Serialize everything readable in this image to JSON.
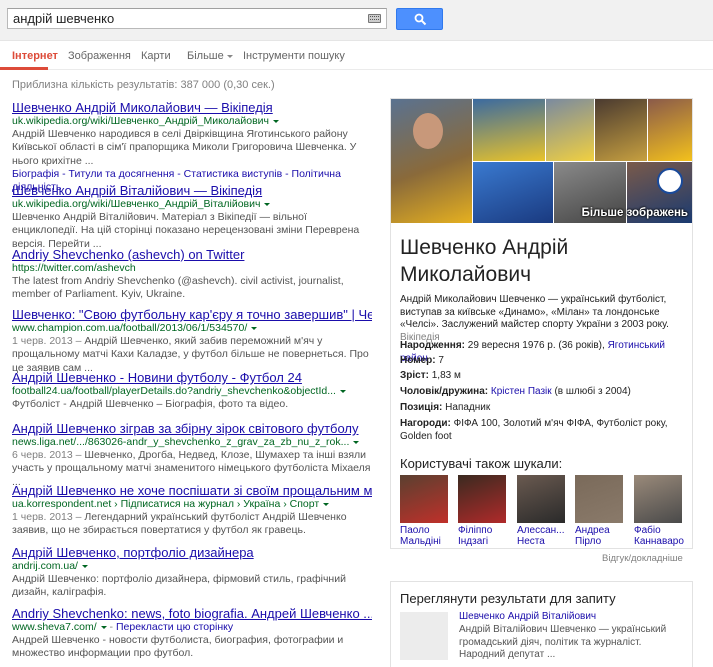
{
  "search": {
    "query": "андрій шевченко",
    "keyboard_icon": "keyboard-icon",
    "button_icon": "magnifier-icon",
    "accent": "#4d90fe"
  },
  "tabs": [
    {
      "label": "Інтернет",
      "active": true
    },
    {
      "label": "Зображення"
    },
    {
      "label": "Карти"
    },
    {
      "label": "Більше"
    },
    {
      "label": "Інструменти пошуку"
    }
  ],
  "stats": "Приблизна кількість результатів: 387 000 (0,30 сек.)",
  "results": [
    {
      "title": "Шевченко Андрій Миколайович — Вікіпедія",
      "url": "uk.wikipedia.org/wiki/Шевченко_Андрій_Миколайович",
      "snippet": "Андрій Шевченко народився в селі Двірківщина Яготинського району Київської області в сім'ї прапорщика Миколи Григоровича Шевченка. У нього крихітне ...",
      "sitelinks": "Біографія - Титули та досягнення - Статистика виступів - Політична діяльність"
    },
    {
      "title": "Шевченко Андрій Віталійович — Вікіпедія",
      "url": "uk.wikipedia.org/wiki/Шевченко_Андрій_Віталійович",
      "snippet": "Шевченко Андрій Віталійович. Матеріал з Вікіпедії — вільної енциклопедії. На цій сторінці показано нерецензовані зміни Переврена версія. Перейти ..."
    },
    {
      "title": "Andriy Shevchenko (ashevch) on Twitter",
      "url": "https://twitter.com/ashevch",
      "snippet": "The latest from Andriy Shevchenko (@ashevch). civil activist, journalist, member of Parliament. Kyiv, Ukraine."
    },
    {
      "title": "Шевченко: \"Свою футбольну кар'єру я точно завершив\" | Чемпіон",
      "url": "www.champion.com.ua/football/2013/06/1/534570/",
      "snippet_date": "1 черв. 2013 –",
      "snippet": "Андрій Шевченко, який забив переможний м'яч у прощальному матчі Кахи Каладзе, у футбол більше не повернеться. Про це заявив сам ..."
    },
    {
      "title": "Андрій Шевченко - Новини футболу - Футбол 24",
      "url": "football24.ua/football/playerDetails.do?andriy_shevchenko&objectId...",
      "snippet": "Футболіст - Андрій Шевченко – Біографія, фото та відео."
    },
    {
      "title": "Андрій Шевченко зіграв за збірну зірок світового футболу",
      "url": "news.liga.net/.../863026-andr_y_shevchenko_z_grav_za_zb_nu_z_rok...",
      "snippet_date": "6 черв. 2013 –",
      "snippet": "Шевченко, Дрогба, Недвед, Клозе, Шумахер та інші взяли участь у прощальному матчі знаменитого німецького футболіста Міхаеля ..."
    },
    {
      "title": "Андрій Шевченко не хоче поспішати зі своїм прощальним мат...",
      "url": "ua.korrespondent.net › Підписатися на журнал › Україна › Спорт",
      "snippet_date": "1 черв. 2013 –",
      "snippet": "Легендарний український футболіст Андрій Шевченко заявив, що не збирається повертатися у футбол як гравець."
    },
    {
      "title": "Андрій Шевченко, портфоліо дизайнера",
      "url": "andrij.com.ua/",
      "snippet": "Андрій Шевченко: портфоліо дизайнера, фірмовий стиль, графічний дизайн, каліграфія."
    },
    {
      "title": "Andriy Shevchenko: news, foto biografia. Андрей Шевченко ...",
      "url": "www.sheva7.com/",
      "url_extra": "Перекласти цю сторінку",
      "snippet": "Андрей Шевченко - новости футболиста, биография, фотографии и множество информации про футбол."
    }
  ],
  "knowledge": {
    "more_images": "Більше зображень",
    "title": "Шевченко Андрій Миколайович",
    "description": "Андрій Миколайович Шевченко — український футболіст, виступав за київське «Динамо», «Мілан» та лондонське «Челсі». Заслужений майстер спорту України з 2003 року.",
    "wiki": "Вікіпедія",
    "facts": [
      {
        "label": "Народження:",
        "value": "29 вересня 1976 р. (36 років),",
        "link": "Яготинський район"
      },
      {
        "label": "Номер:",
        "value": "7"
      },
      {
        "label": "Зріст:",
        "value": "1,83 м"
      },
      {
        "label": "Чоловік/дружина:",
        "link": "Крістен Пазік",
        "value": "(в шлюбі з 2004)"
      },
      {
        "label": "Позиція:",
        "value": "Нападник"
      },
      {
        "label": "Нагороди:",
        "value": "ФІФА 100, Золотий м'яч ФІФА, Футболіст року, Golden foot"
      }
    ],
    "also_heading": "Користувачі також шукали:",
    "people": [
      {
        "name": "Паоло Мальдіні"
      },
      {
        "name": "Філіппо Індзагі"
      },
      {
        "name": "Алессан... Неста"
      },
      {
        "name": "Андреа Пірло"
      },
      {
        "name": "Фабіо Каннаваро"
      }
    ],
    "feedback": "Відгук/докладніше"
  },
  "related": {
    "heading": "Переглянути результати для запиту",
    "title": "Шевченко Андрій Віталійович",
    "snippet": "Андрій Віталійович Шевченко — український громадський діяч, політик та журналіст. Народний депутат ..."
  }
}
